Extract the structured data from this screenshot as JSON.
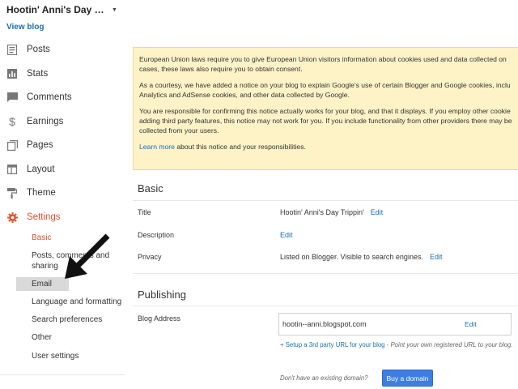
{
  "sidebar": {
    "blog_title": "Hootin' Anni's Day Tripp...",
    "view_blog": "View blog",
    "items": [
      {
        "label": "Posts",
        "icon": "posts-icon"
      },
      {
        "label": "Stats",
        "icon": "stats-icon"
      },
      {
        "label": "Comments",
        "icon": "comments-icon"
      },
      {
        "label": "Earnings",
        "icon": "earnings-icon"
      },
      {
        "label": "Pages",
        "icon": "pages-icon"
      },
      {
        "label": "Layout",
        "icon": "layout-icon"
      },
      {
        "label": "Theme",
        "icon": "theme-icon"
      },
      {
        "label": "Settings",
        "icon": "settings-icon"
      }
    ],
    "settings_sub": {
      "basic": "Basic",
      "posts_line1": "Posts, comments and",
      "posts_line2": "sharing",
      "email": "Email",
      "language": "Language and formatting",
      "search": "Search preferences",
      "other": "Other",
      "user": "User settings"
    }
  },
  "notice": {
    "p1_line1": "European Union laws require you to give European Union visitors information about cookies used and data collected on",
    "p1_line2": "cases, these laws also require you to obtain consent.",
    "p2_line1": "As a courtesy, we have added a notice on your blog to explain Google's use of certain Blogger and Google cookies, inclu",
    "p2_line2": "Analytics and AdSense cookies, and other data collected by Google.",
    "p3_line1": "You are responsible for confirming this notice actually works for your blog, and that it displays. If you employ other cookie",
    "p3_line2": "adding third party features, this notice may not work for you. If you include functionality from other providers there may be",
    "p3_line3": "collected from your users.",
    "learn_more": "Learn more",
    "learn_more_rest": " about this notice and your responsibilities."
  },
  "basic": {
    "heading": "Basic",
    "title_label": "Title",
    "title_value": "Hootin' Anni's Day Trippin'",
    "description_label": "Description",
    "privacy_label": "Privacy",
    "privacy_value": "Listed on Blogger. Visible to search engines.",
    "edit": "Edit"
  },
  "publishing": {
    "heading": "Publishing",
    "blog_address_label": "Blog Address",
    "blog_address_value": "hootin--anni.blogspot.com",
    "edit": "Edit",
    "setup_link": "+ Setup a 3rd party URL for your blog",
    "setup_rest": " - Point your own registered URL to your blog.",
    "no_domain": "Don't have an existing domain?",
    "buy_domain": "Buy a domain"
  },
  "colors": {
    "accent": "#e1532b",
    "link": "#1a6fb5",
    "notice_bg": "#fdf3c7",
    "button": "#3d7ee3"
  }
}
